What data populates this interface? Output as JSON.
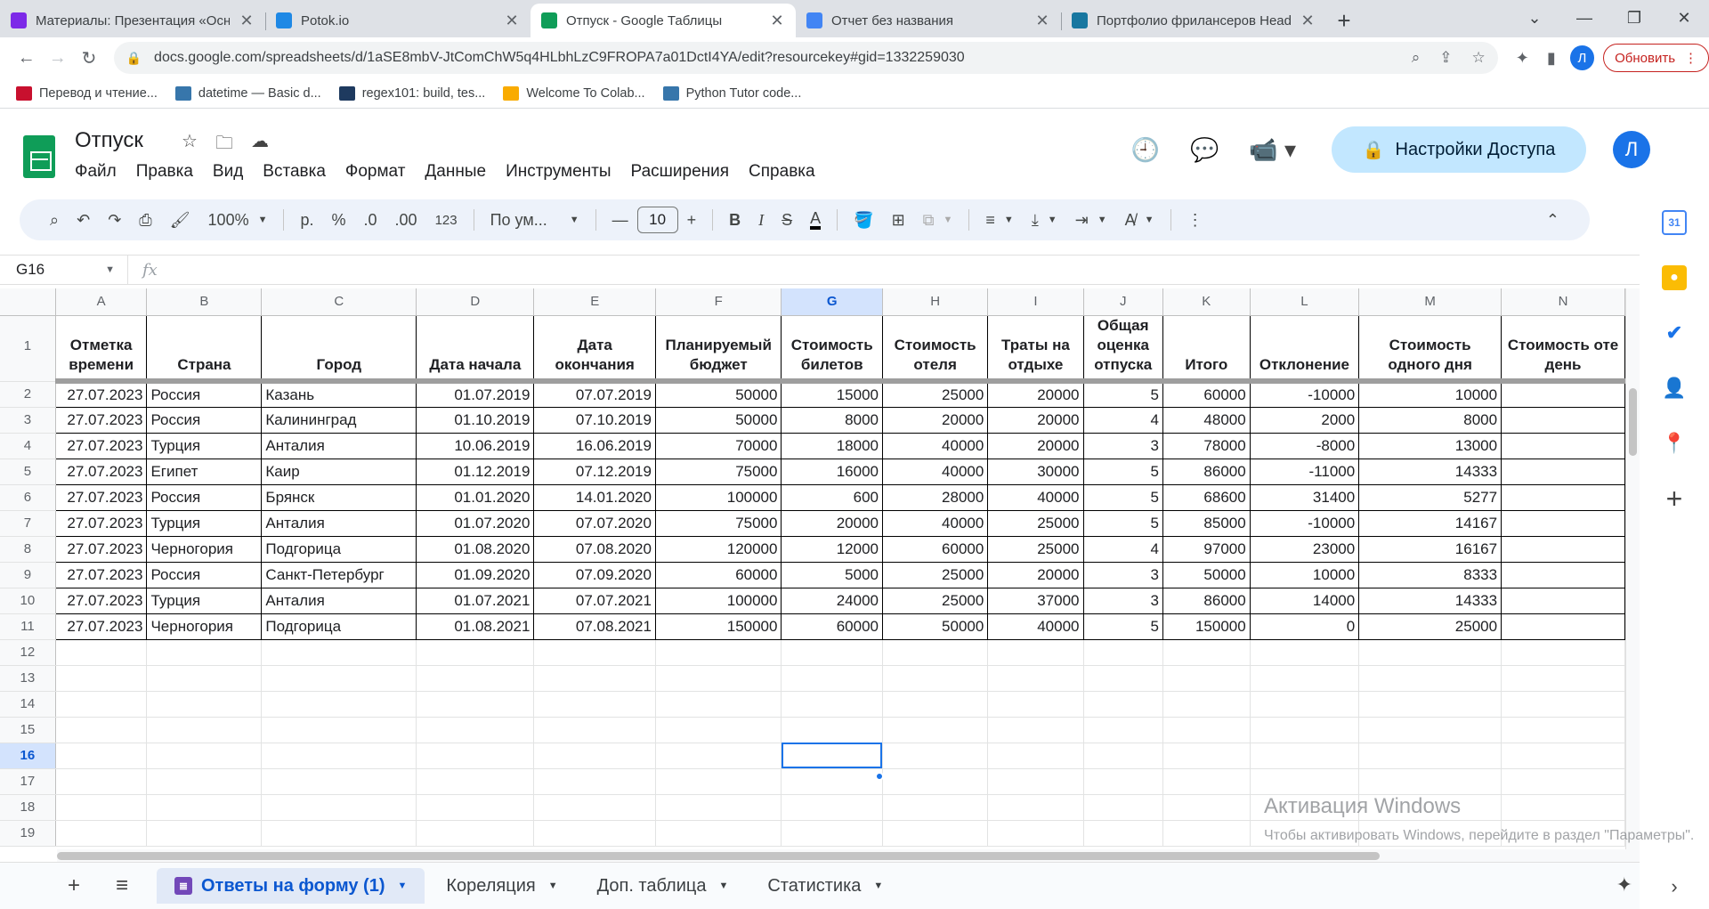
{
  "browser": {
    "tabs": [
      {
        "title": "Материалы: Презентация «Осн",
        "active": false,
        "favicon": "canva-icon",
        "favicon_color": "#7d2ae8"
      },
      {
        "title": "Potok.io",
        "active": false,
        "favicon": "potok-icon",
        "favicon_color": "#1e88e5"
      },
      {
        "title": "Отпуск - Google Таблицы",
        "active": true,
        "favicon": "sheets-icon",
        "favicon_color": "#0f9d58"
      },
      {
        "title": "Отчет без названия",
        "active": false,
        "favicon": "looker-icon",
        "favicon_color": "#4285f4"
      },
      {
        "title": "Портфолио фрилансеров Headh",
        "active": false,
        "favicon": "habr-icon",
        "favicon_color": "#1877a0"
      }
    ],
    "url": "docs.google.com/spreadsheets/d/1aSE8mbV-JtComChW5q4HLbhLzC9FROPA7a01DctI4YA/edit?resourcekey#gid=1332259030",
    "profile_initial": "Л",
    "update_label": "Обновить",
    "bookmarks": [
      {
        "label": "Перевод и чтение...",
        "icon": "uk-flag-icon",
        "color": "#c8102e"
      },
      {
        "label": "datetime — Basic d...",
        "icon": "python-icon",
        "color": "#3776ab"
      },
      {
        "label": "regex101: build, tes...",
        "icon": "regex101-icon",
        "color": "#1e3a5f"
      },
      {
        "label": "Welcome To Colab...",
        "icon": "colab-icon",
        "color": "#f9ab00"
      },
      {
        "label": "Python Tutor code...",
        "icon": "python-icon",
        "color": "#3776ab"
      }
    ]
  },
  "doc": {
    "title": "Отпуск",
    "menu": [
      "Файл",
      "Правка",
      "Вид",
      "Вставка",
      "Формат",
      "Данные",
      "Инструменты",
      "Расширения",
      "Справка"
    ],
    "share_label": "Настройки Доступа",
    "avatar_initial": "Л"
  },
  "toolbar": {
    "zoom": "100%",
    "currency": "р.",
    "percent": "%",
    "dec_decrease": ".0",
    "dec_increase": ".00",
    "number_format": "123",
    "font": "По ум...",
    "font_size": "10"
  },
  "formula_bar": {
    "cell_ref": "G16",
    "fx": "fx",
    "content": ""
  },
  "grid": {
    "columns": [
      "A",
      "B",
      "C",
      "D",
      "E",
      "F",
      "G",
      "H",
      "I",
      "J",
      "K",
      "L",
      "M",
      "N"
    ],
    "selected_column": "G",
    "selected_row": 16,
    "headers": [
      [
        "Отметка",
        "времени"
      ],
      [
        "Страна"
      ],
      [
        "Город"
      ],
      [
        "Дата начала"
      ],
      [
        "Дата",
        "окончания"
      ],
      [
        "Планируемый",
        "бюджет"
      ],
      [
        "Стоимость",
        "билетов"
      ],
      [
        "Стоимость",
        "отеля"
      ],
      [
        "Траты на",
        "отдыхе"
      ],
      [
        "Общая",
        "оценка",
        "отпуска"
      ],
      [
        "Итого"
      ],
      [
        "Отклонение"
      ],
      [
        "Стоимость",
        "одного дня"
      ],
      [
        "Стоимость оте",
        "день"
      ]
    ],
    "rows": [
      [
        "27.07.2023",
        "Россия",
        "Казань",
        "01.07.2019",
        "07.07.2019",
        "50000",
        "15000",
        "25000",
        "20000",
        "5",
        "60000",
        "-10000",
        "10000",
        ""
      ],
      [
        "27.07.2023",
        "Россия",
        "Калининград",
        "01.10.2019",
        "07.10.2019",
        "50000",
        "8000",
        "20000",
        "20000",
        "4",
        "48000",
        "2000",
        "8000",
        ""
      ],
      [
        "27.07.2023",
        "Турция",
        "Анталия",
        "10.06.2019",
        "16.06.2019",
        "70000",
        "18000",
        "40000",
        "20000",
        "3",
        "78000",
        "-8000",
        "13000",
        ""
      ],
      [
        "27.07.2023",
        "Египет",
        "Каир",
        "01.12.2019",
        "07.12.2019",
        "75000",
        "16000",
        "40000",
        "30000",
        "5",
        "86000",
        "-11000",
        "14333",
        ""
      ],
      [
        "27.07.2023",
        "Россия",
        "Брянск",
        "01.01.2020",
        "14.01.2020",
        "100000",
        "600",
        "28000",
        "40000",
        "5",
        "68600",
        "31400",
        "5277",
        ""
      ],
      [
        "27.07.2023",
        "Турция",
        "Анталия",
        "01.07.2020",
        "07.07.2020",
        "75000",
        "20000",
        "40000",
        "25000",
        "5",
        "85000",
        "-10000",
        "14167",
        ""
      ],
      [
        "27.07.2023",
        "Черногория",
        "Подгорица",
        "01.08.2020",
        "07.08.2020",
        "120000",
        "12000",
        "60000",
        "25000",
        "4",
        "97000",
        "23000",
        "16167",
        ""
      ],
      [
        "27.07.2023",
        "Россия",
        "Санкт-Петербург",
        "01.09.2020",
        "07.09.2020",
        "60000",
        "5000",
        "25000",
        "20000",
        "3",
        "50000",
        "10000",
        "8333",
        ""
      ],
      [
        "27.07.2023",
        "Турция",
        "Анталия",
        "01.07.2021",
        "07.07.2021",
        "100000",
        "24000",
        "25000",
        "37000",
        "3",
        "86000",
        "14000",
        "14333",
        ""
      ],
      [
        "27.07.2023",
        "Черногория",
        "Подгорица",
        "01.08.2021",
        "07.08.2021",
        "150000",
        "60000",
        "50000",
        "40000",
        "5",
        "150000",
        "0",
        "25000",
        ""
      ]
    ],
    "empty_rows": [
      12,
      13,
      14,
      15,
      16,
      17,
      18,
      19
    ]
  },
  "sheet_tabs": [
    {
      "label": "Ответы на форму (1)",
      "active": true
    },
    {
      "label": "Кореляция",
      "active": false
    },
    {
      "label": "Доп. таблица",
      "active": false
    },
    {
      "label": "Статистика",
      "active": false
    }
  ],
  "watermark": {
    "title": "Активация Windows",
    "text": "Чтобы активировать Windows, перейдите в раздел \"Параметры\"."
  }
}
